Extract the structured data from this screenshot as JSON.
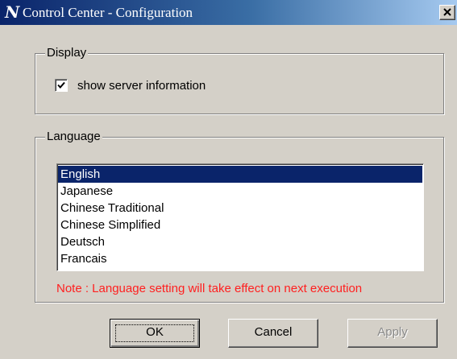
{
  "window": {
    "logo": "N",
    "title": "Control Center - Configuration"
  },
  "display_group": {
    "title": "Display",
    "show_server_info": {
      "label": "show server information",
      "checked": true
    }
  },
  "language_group": {
    "title": "Language",
    "options": [
      "English",
      "Japanese",
      "Chinese Traditional",
      "Chinese Simplified",
      "Deutsch",
      "Francais"
    ],
    "selected": "English",
    "note": "Note : Language setting will take effect on next execution"
  },
  "buttons": {
    "ok": "OK",
    "cancel": "Cancel",
    "apply": "Apply"
  },
  "colors": {
    "titlebar_start": "#0a246a",
    "selection": "#0a246a",
    "note_text": "#ff2020",
    "dialog_face": "#d4d0c8"
  }
}
